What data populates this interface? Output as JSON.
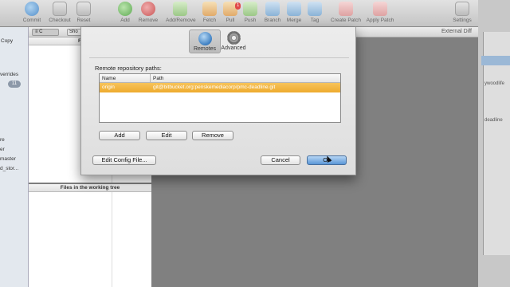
{
  "toolbar": {
    "items": [
      {
        "label": "Commit",
        "icon": "commit-icon"
      },
      {
        "label": "Checkout",
        "icon": "checkout-icon"
      },
      {
        "label": "Reset",
        "icon": "reset-icon"
      },
      {
        "label": "Add",
        "icon": "add-icon"
      },
      {
        "label": "Remove",
        "icon": "remove-icon"
      },
      {
        "label": "Add/Remove",
        "icon": "add-remove-icon"
      },
      {
        "label": "Fetch",
        "icon": "fetch-icon"
      },
      {
        "label": "Pull",
        "icon": "pull-icon",
        "badge": "1"
      },
      {
        "label": "Push",
        "icon": "push-icon"
      },
      {
        "label": "Branch",
        "icon": "branch-icon"
      },
      {
        "label": "Merge",
        "icon": "merge-icon"
      },
      {
        "label": "Tag",
        "icon": "tag-icon"
      },
      {
        "label": "Create Patch",
        "icon": "create-patch-icon"
      },
      {
        "label": "Apply Patch",
        "icon": "apply-patch-icon"
      },
      {
        "label": "Settings",
        "icon": "settings-icon"
      }
    ]
  },
  "sidebar": {
    "items": [
      "Copy",
      "verrides",
      "re",
      "er",
      "master",
      "d_stor..."
    ],
    "badge": "11"
  },
  "filter": {
    "control_a": "≡ C",
    "control_b": "Sho"
  },
  "panels": {
    "staged_header": "Files stag",
    "working_header": "Files in the working tree"
  },
  "diff": {
    "label": "External Diff"
  },
  "right_edge": {
    "texts": [
      "ywoodlife",
      "deadline"
    ]
  },
  "sheet": {
    "tabs": [
      {
        "label": "Remotes",
        "active": true
      },
      {
        "label": "Advanced",
        "active": false
      }
    ],
    "section_label": "Remote repository paths:",
    "table": {
      "columns": [
        "Name",
        "Path"
      ],
      "rows": [
        {
          "name": "origin",
          "path": "git@bitbucket.org:penskemediacorp/pmc-deadline.git"
        }
      ]
    },
    "buttons": {
      "add": "Add",
      "edit": "Edit",
      "remove": "Remove",
      "edit_config": "Edit Config File...",
      "cancel": "Cancel",
      "ok": "Ok"
    }
  }
}
